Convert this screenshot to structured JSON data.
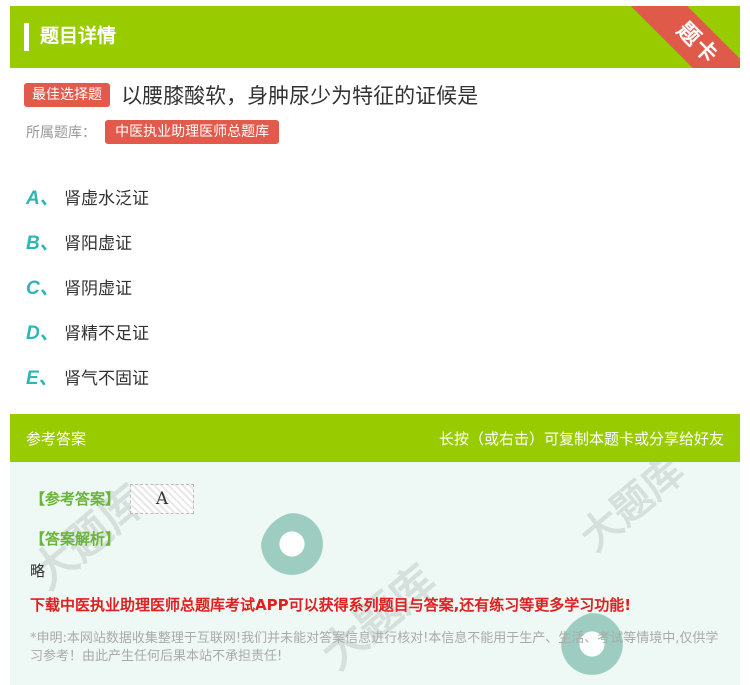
{
  "header": {
    "title": "题目详情",
    "corner_label": "题卡"
  },
  "question": {
    "type_badge": "最佳选择题",
    "text": "以腰膝酸软，身肿尿少为特征的证候是",
    "bank_label": "所属题库：",
    "bank_name": "中医执业助理医师总题库"
  },
  "options": [
    {
      "letter": "A、",
      "text": "肾虚水泛证"
    },
    {
      "letter": "B、",
      "text": "肾阳虚证"
    },
    {
      "letter": "C、",
      "text": "肾阴虚证"
    },
    {
      "letter": "D、",
      "text": "肾精不足证"
    },
    {
      "letter": "E、",
      "text": "肾气不固证"
    }
  ],
  "answer_section": {
    "title": "参考答案",
    "hint": "长按（或右击）可复制本题卡或分享给好友",
    "answer_label": "【参考答案】",
    "answer_value": "A",
    "analysis_label": "【答案解析】",
    "analysis_text": "略",
    "promo": "下载中医执业助理医师总题库考试APP可以获得系列题目与答案,还有练习等更多学习功能!",
    "disclaimer": "*申明:本网站数据收集整理于互联网!我们并未能对答案信息进行核对!本信息不能用于生产、生活、考试等情境中,仅供学习参考！由此产生任何后果本站不承担责任!"
  },
  "colors": {
    "accent_green": "#99cc00",
    "badge_red": "#e25a4c",
    "option_letter": "#2cb6b6",
    "promo_red": "#e02020"
  }
}
